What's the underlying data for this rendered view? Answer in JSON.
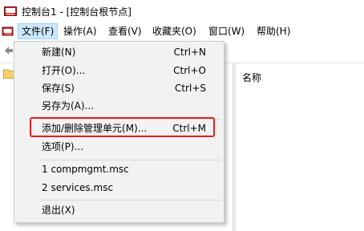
{
  "window": {
    "title": "控制台1 - [控制台根节点]",
    "app_icon": "mmc-console-icon"
  },
  "menubar": {
    "document_icon": "mdi-document-icon",
    "items": [
      {
        "label": "文件(F)",
        "active": true
      },
      {
        "label": "操作(A)"
      },
      {
        "label": "查看(V)"
      },
      {
        "label": "收藏夹(O)"
      },
      {
        "label": "窗口(W)"
      },
      {
        "label": "帮助(H)"
      }
    ]
  },
  "toolbar": {
    "back_icon": "back-arrow-icon"
  },
  "tree": {
    "root_icon": "folder-icon"
  },
  "list": {
    "column_name": "名称"
  },
  "file_menu": {
    "items": [
      {
        "label": "新建(N)",
        "shortcut": "Ctrl+N"
      },
      {
        "label": "打开(O)...",
        "shortcut": "Ctrl+O"
      },
      {
        "label": "保存(S)",
        "shortcut": "Ctrl+S"
      },
      {
        "label": "另存为(A)...",
        "shortcut": ""
      },
      {
        "label": "添加/删除管理单元(M)...",
        "shortcut": "Ctrl+M",
        "highlighted": true
      },
      {
        "label": "选项(P)...",
        "shortcut": ""
      },
      {
        "label": "1 compmgmt.msc",
        "shortcut": ""
      },
      {
        "label": "2 services.msc",
        "shortcut": ""
      },
      {
        "label": "退出(X)",
        "shortcut": ""
      }
    ]
  },
  "colors": {
    "menu_active_bg": "#cce8ff",
    "dropdown_bg": "#f2f2f2",
    "highlight_border": "#e02020"
  }
}
